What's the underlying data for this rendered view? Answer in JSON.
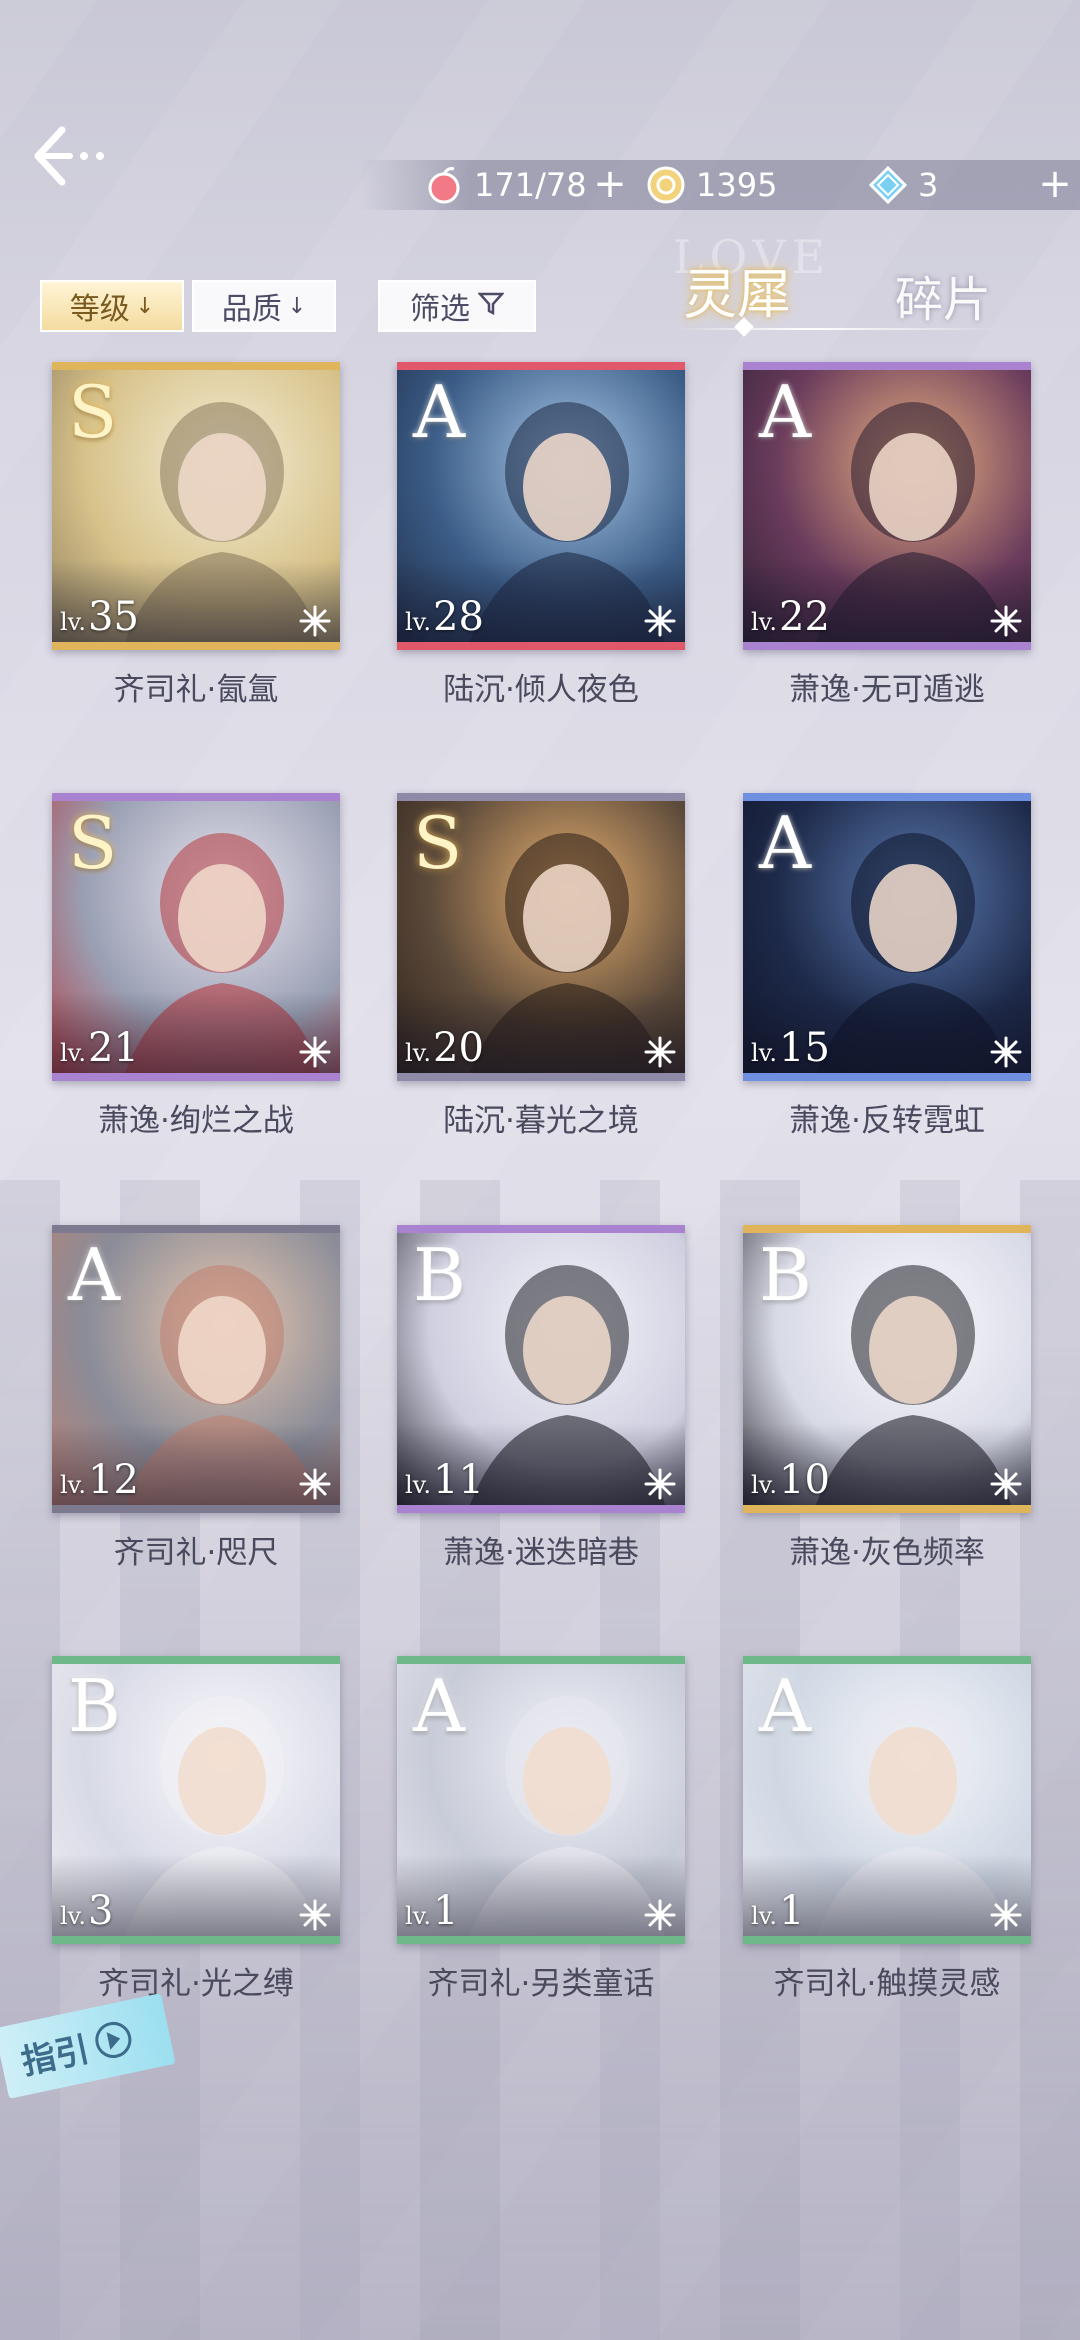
{
  "header": {
    "stamina": "171/78",
    "gold": "1395",
    "diamond": "3"
  },
  "filters": {
    "level": "等级",
    "quality": "品质",
    "screen": "筛选"
  },
  "tabs": {
    "ghost": "LOVE",
    "selected": "灵犀",
    "other": "碎片"
  },
  "cards": [
    {
      "grade": "S",
      "lv_prefix": "lv.",
      "level": "35",
      "name": "齐司礼·氤氲",
      "color": "#e0b45a"
    },
    {
      "grade": "A",
      "lv_prefix": "lv.",
      "level": "28",
      "name": "陆沉·倾人夜色",
      "color": "#e0586a"
    },
    {
      "grade": "A",
      "lv_prefix": "lv.",
      "level": "22",
      "name": "萧逸·无可遁逃",
      "color": "#a983d0"
    },
    {
      "grade": "S",
      "lv_prefix": "lv.",
      "level": "21",
      "name": "萧逸·绚烂之战",
      "color": "#a983d0"
    },
    {
      "grade": "S",
      "lv_prefix": "lv.",
      "level": "20",
      "name": "陆沉·暮光之境",
      "color": "#8f8aa8"
    },
    {
      "grade": "A",
      "lv_prefix": "lv.",
      "level": "15",
      "name": "萧逸·反转霓虹",
      "color": "#6f8fe0"
    },
    {
      "grade": "A",
      "lv_prefix": "lv.",
      "level": "12",
      "name": "齐司礼·咫尺",
      "color": "#7d7a90"
    },
    {
      "grade": "B",
      "lv_prefix": "lv.",
      "level": "11",
      "name": "萧逸·迷迭暗巷",
      "color": "#a983d0"
    },
    {
      "grade": "B",
      "lv_prefix": "lv.",
      "level": "10",
      "name": "萧逸·灰色频率",
      "color": "#e0b45a"
    },
    {
      "grade": "B",
      "lv_prefix": "lv.",
      "level": "3",
      "name": "齐司礼·光之缚",
      "color": "#6fb88a"
    },
    {
      "grade": "A",
      "lv_prefix": "lv.",
      "level": "1",
      "name": "齐司礼·另类童话",
      "color": "#6fb88a"
    },
    {
      "grade": "A",
      "lv_prefix": "lv.",
      "level": "1",
      "name": "齐司礼·触摸灵感",
      "color": "#6fb88a"
    }
  ],
  "guide": {
    "label": "指引"
  }
}
